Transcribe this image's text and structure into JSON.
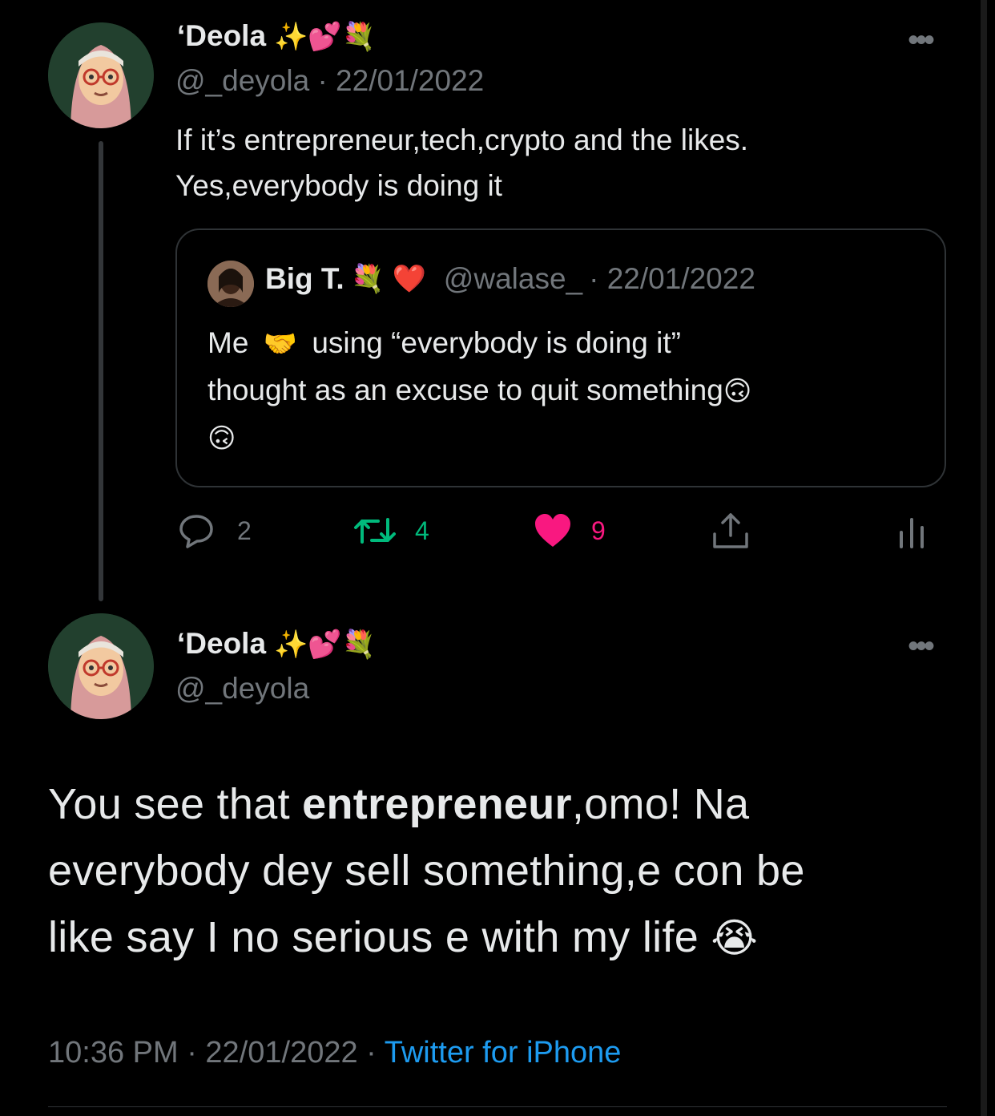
{
  "tweet1": {
    "name": "‘Deola",
    "name_emojis": "✨💕💐",
    "handle": "@_deyola",
    "date": "· 22/01/2022",
    "text_line1": "If it’s entrepreneur,tech,crypto and the likes.",
    "text_line2": "Yes,everybody is doing it",
    "more_label": "•••"
  },
  "quote": {
    "name": "Big T.",
    "name_emojis": "💐 ❤️",
    "handle": "@walase_",
    "date": "· 22/01/2022",
    "text_line1_a": "Me",
    "text_line1_emoji": "🤝",
    "text_line1_b": "using “everybody is doing it”",
    "text_line2": "thought as an excuse to quit something",
    "text_line2_emoji": "🙃",
    "text_line3_emoji": "🙃"
  },
  "actions": {
    "reply_count": "2",
    "retweet_count": "4",
    "like_count": "9",
    "reply_icon": "reply-icon",
    "retweet_icon": "retweet-icon",
    "like_icon": "heart-icon",
    "share_icon": "share-icon",
    "analytics_icon": "analytics-icon",
    "retweet_color": "#00ba7c",
    "like_color": "#f91880"
  },
  "tweet2": {
    "name": "‘Deola",
    "name_emojis": "✨💕💐",
    "handle": "@_deyola",
    "more_label": "•••",
    "text_a": "You see that ",
    "text_bold": "entrepreneur",
    "text_b": ",omo! Na",
    "text_line2": "everybody dey sell something,e con be",
    "text_line3": "like say I no serious e with my life",
    "text_emoji": "😭",
    "time": "10:36 PM · 22/01/2022 · ",
    "source": "Twitter for iPhone",
    "source_color": "#1d9bf0"
  }
}
